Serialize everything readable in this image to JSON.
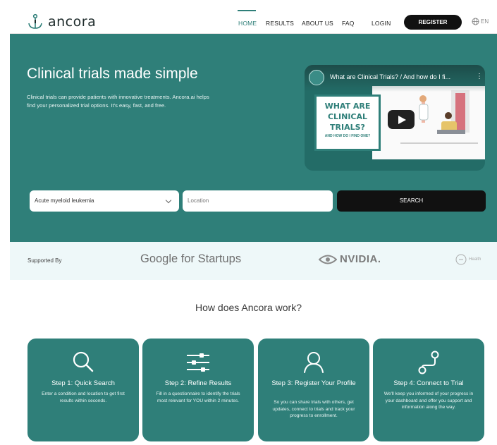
{
  "nav": {
    "logo_text": "ancora",
    "links": [
      "HOME",
      "RESULTS",
      "ABOUT US",
      "FAQ",
      "LOGIN"
    ],
    "register_label": "REGISTER",
    "lang_label": "EN"
  },
  "hero": {
    "title": "Clinical trials made simple",
    "description": "Clinical trials can provide patients with innovative treatments. Ancora.ai helps find your personalized trial options. It's easy, fast, and free.",
    "video": {
      "title": "What are Clinical Trials? / And how do I fi...",
      "card_lines": [
        "WHAT ARE",
        "CLINICAL",
        "TRIALS?"
      ],
      "card_small": "AND HOW DO I FIND ONE?"
    },
    "search": {
      "condition_value": "Acute myeloid leukemia",
      "location_placeholder": "Location",
      "button_label": "SEARCH"
    }
  },
  "supported": {
    "label": "Supported By",
    "google": "Google for Startups",
    "nvidia": "NVIDIA.",
    "health": "Health"
  },
  "how": {
    "title": "How does Ancora work?",
    "steps": [
      {
        "title": "Step 1: Quick Search",
        "desc": "Enter a condition and location to get first results within seconds.",
        "icon": "magnifier-icon"
      },
      {
        "title": "Step 2: Refine Results",
        "desc": "Fill in a questionnaire to identify the trials most relevant for YOU within 2 minutes.",
        "icon": "sliders-icon"
      },
      {
        "title": "Step 3: Register Your Profile",
        "desc": "So you can share trials with others, get updates, connect to trials and track your progress to enrollment.",
        "icon": "user-icon"
      },
      {
        "title": "Step 4: Connect to Trial",
        "desc": "We'll keep you informed of your progress in your dashboard and offer you support and information along the way.",
        "icon": "connect-icon"
      }
    ]
  },
  "colors": {
    "teal": "#2f7f79",
    "light": "#eef8f9",
    "dark": "#111111"
  }
}
